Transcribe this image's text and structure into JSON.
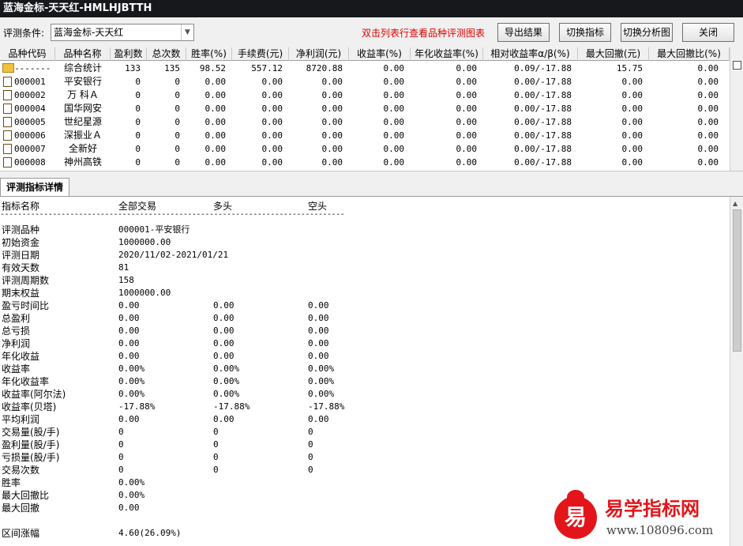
{
  "window": {
    "title": "蓝海金标-天天红-HMLHJBTTH"
  },
  "toolbar": {
    "condition_label": "评测条件:",
    "condition_value": "蓝海金标-天天红",
    "hint": "双击列表行查看品种评测图表",
    "export_label": "导出结果",
    "switch_indicator_label": "切换指标",
    "switch_chart_label": "切换分析图",
    "close_label": "关闭"
  },
  "grid": {
    "headers": [
      "品种代码",
      "品种名称",
      "盈利数",
      "总次数",
      "胜率(%)",
      "手续费(元)",
      "净利润(元)",
      "收益率(%)",
      "年化收益率(%)",
      "相对收益率α/β(%)",
      "最大回撤(元)",
      "最大回撤比(%)"
    ],
    "rows": [
      [
        "-------",
        "综合统计",
        "133",
        "135",
        "98.52",
        "557.12",
        "8720.88",
        "0.00",
        "0.00",
        "0.09/-17.88",
        "15.75",
        "0.00"
      ],
      [
        "000001",
        "平安银行",
        "0",
        "0",
        "0.00",
        "0.00",
        "0.00",
        "0.00",
        "0.00",
        "0.00/-17.88",
        "0.00",
        "0.00"
      ],
      [
        "000002",
        "万 科Ａ",
        "0",
        "0",
        "0.00",
        "0.00",
        "0.00",
        "0.00",
        "0.00",
        "0.00/-17.88",
        "0.00",
        "0.00"
      ],
      [
        "000004",
        "国华网安",
        "0",
        "0",
        "0.00",
        "0.00",
        "0.00",
        "0.00",
        "0.00",
        "0.00/-17.88",
        "0.00",
        "0.00"
      ],
      [
        "000005",
        "世纪星源",
        "0",
        "0",
        "0.00",
        "0.00",
        "0.00",
        "0.00",
        "0.00",
        "0.00/-17.88",
        "0.00",
        "0.00"
      ],
      [
        "000006",
        "深振业Ａ",
        "0",
        "0",
        "0.00",
        "0.00",
        "0.00",
        "0.00",
        "0.00",
        "0.00/-17.88",
        "0.00",
        "0.00"
      ],
      [
        "000007",
        "全新好",
        "0",
        "0",
        "0.00",
        "0.00",
        "0.00",
        "0.00",
        "0.00",
        "0.00/-17.88",
        "0.00",
        "0.00"
      ],
      [
        "000008",
        "神州高铁",
        "0",
        "0",
        "0.00",
        "0.00",
        "0.00",
        "0.00",
        "0.00",
        "0.00/-17.88",
        "0.00",
        "0.00"
      ]
    ]
  },
  "detail": {
    "tab_label": "评测指标详情",
    "headers": [
      "指标名称",
      "全部交易",
      "多头",
      "空头"
    ],
    "separator": "--------------------------------------------------------------------------------------------------------",
    "rows": [
      [
        "评测品种",
        "000001-平安银行",
        "",
        ""
      ],
      [
        "初始资金",
        "1000000.00",
        "",
        ""
      ],
      [
        "评测日期",
        "2020/11/02-2021/01/21",
        "",
        ""
      ],
      [
        "有效天数",
        "81",
        "",
        ""
      ],
      [
        "评测周期数",
        "158",
        "",
        ""
      ],
      [
        "期末权益",
        "1000000.00",
        "",
        ""
      ],
      [
        "盈亏时间比",
        "0.00",
        "0.00",
        "0.00"
      ],
      [
        "总盈利",
        "0.00",
        "0.00",
        "0.00"
      ],
      [
        "总亏损",
        "0.00",
        "0.00",
        "0.00"
      ],
      [
        "净利润",
        "0.00",
        "0.00",
        "0.00"
      ],
      [
        "年化收益",
        "0.00",
        "0.00",
        "0.00"
      ],
      [
        "收益率",
        "0.00%",
        "0.00%",
        "0.00%"
      ],
      [
        "年化收益率",
        "0.00%",
        "0.00%",
        "0.00%"
      ],
      [
        "收益率(阿尔法)",
        "0.00%",
        "0.00%",
        "0.00%"
      ],
      [
        "收益率(贝塔)",
        "-17.88%",
        "-17.88%",
        "-17.88%"
      ],
      [
        "平均利润",
        "0.00",
        "0.00",
        "0.00"
      ],
      [
        "交易量(股/手)",
        "0",
        "0",
        "0"
      ],
      [
        "盈利量(股/手)",
        "0",
        "0",
        "0"
      ],
      [
        "亏损量(股/手)",
        "0",
        "0",
        "0"
      ],
      [
        "交易次数",
        "0",
        "0",
        "0"
      ],
      [
        "胜率",
        "0.00%",
        "",
        ""
      ],
      [
        "最大回撤比",
        "0.00%",
        "",
        ""
      ],
      [
        "最大回撤",
        "0.00",
        "",
        ""
      ],
      [
        "",
        "",
        "",
        ""
      ],
      [
        "区间涨幅",
        "4.60(26.09%)",
        "",
        ""
      ]
    ]
  },
  "watermark": {
    "logo_char": "易",
    "title": "易学指标网",
    "url": "www.108096.com",
    "brand_color": "#e3151a"
  }
}
